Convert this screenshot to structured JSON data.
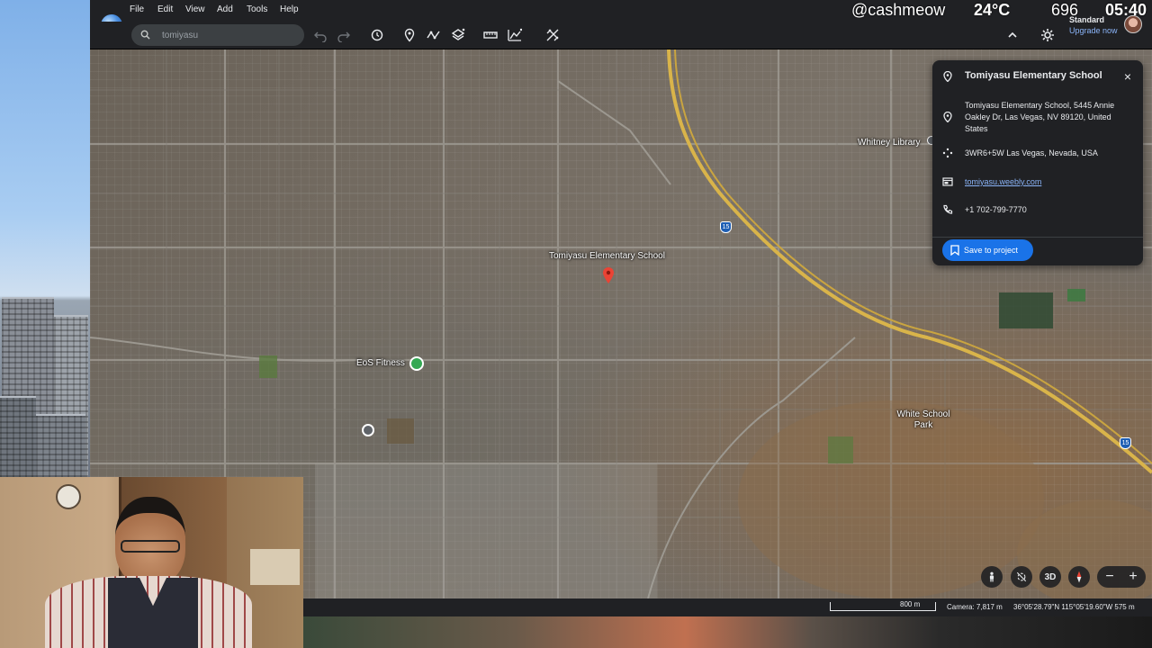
{
  "app": {
    "menu": [
      "File",
      "Edit",
      "View",
      "Add",
      "Tools",
      "Help"
    ],
    "search_value": "tomiyasu",
    "account": {
      "tier": "Standard",
      "upgrade": "Upgrade now"
    }
  },
  "stream_overlay": {
    "handle": "@cashmeow",
    "temperature": "24°C",
    "count": "696",
    "time": "05:40"
  },
  "map": {
    "labels": {
      "school": "Tomiyasu Elementary School",
      "library": "Whitney Library",
      "fitness": "EoS Fitness",
      "park": "White School Park",
      "interstate": "15"
    },
    "scale": "800 m",
    "camera": "Camera: 7,817 m",
    "coordinates": "36°05'28.79\"N 115°05'19.60\"W  575 m",
    "controls": {
      "view_3d": "3D"
    }
  },
  "place_card": {
    "title": "Tomiyasu Elementary School",
    "address": "Tomiyasu Elementary School, 5445 Annie Oakley Dr, Las Vegas, NV 89120, United States",
    "plus_code": "3WR6+5W Las Vegas, Nevada, USA",
    "website": "tomiyasu.weebly.com",
    "phone": "+1 702-799-7770",
    "save_button": "Save to project"
  },
  "colors": {
    "accent": "#1a73e8",
    "pin": "#ea4335",
    "poi_green": "#34a853",
    "highway": "#d9b44a"
  }
}
